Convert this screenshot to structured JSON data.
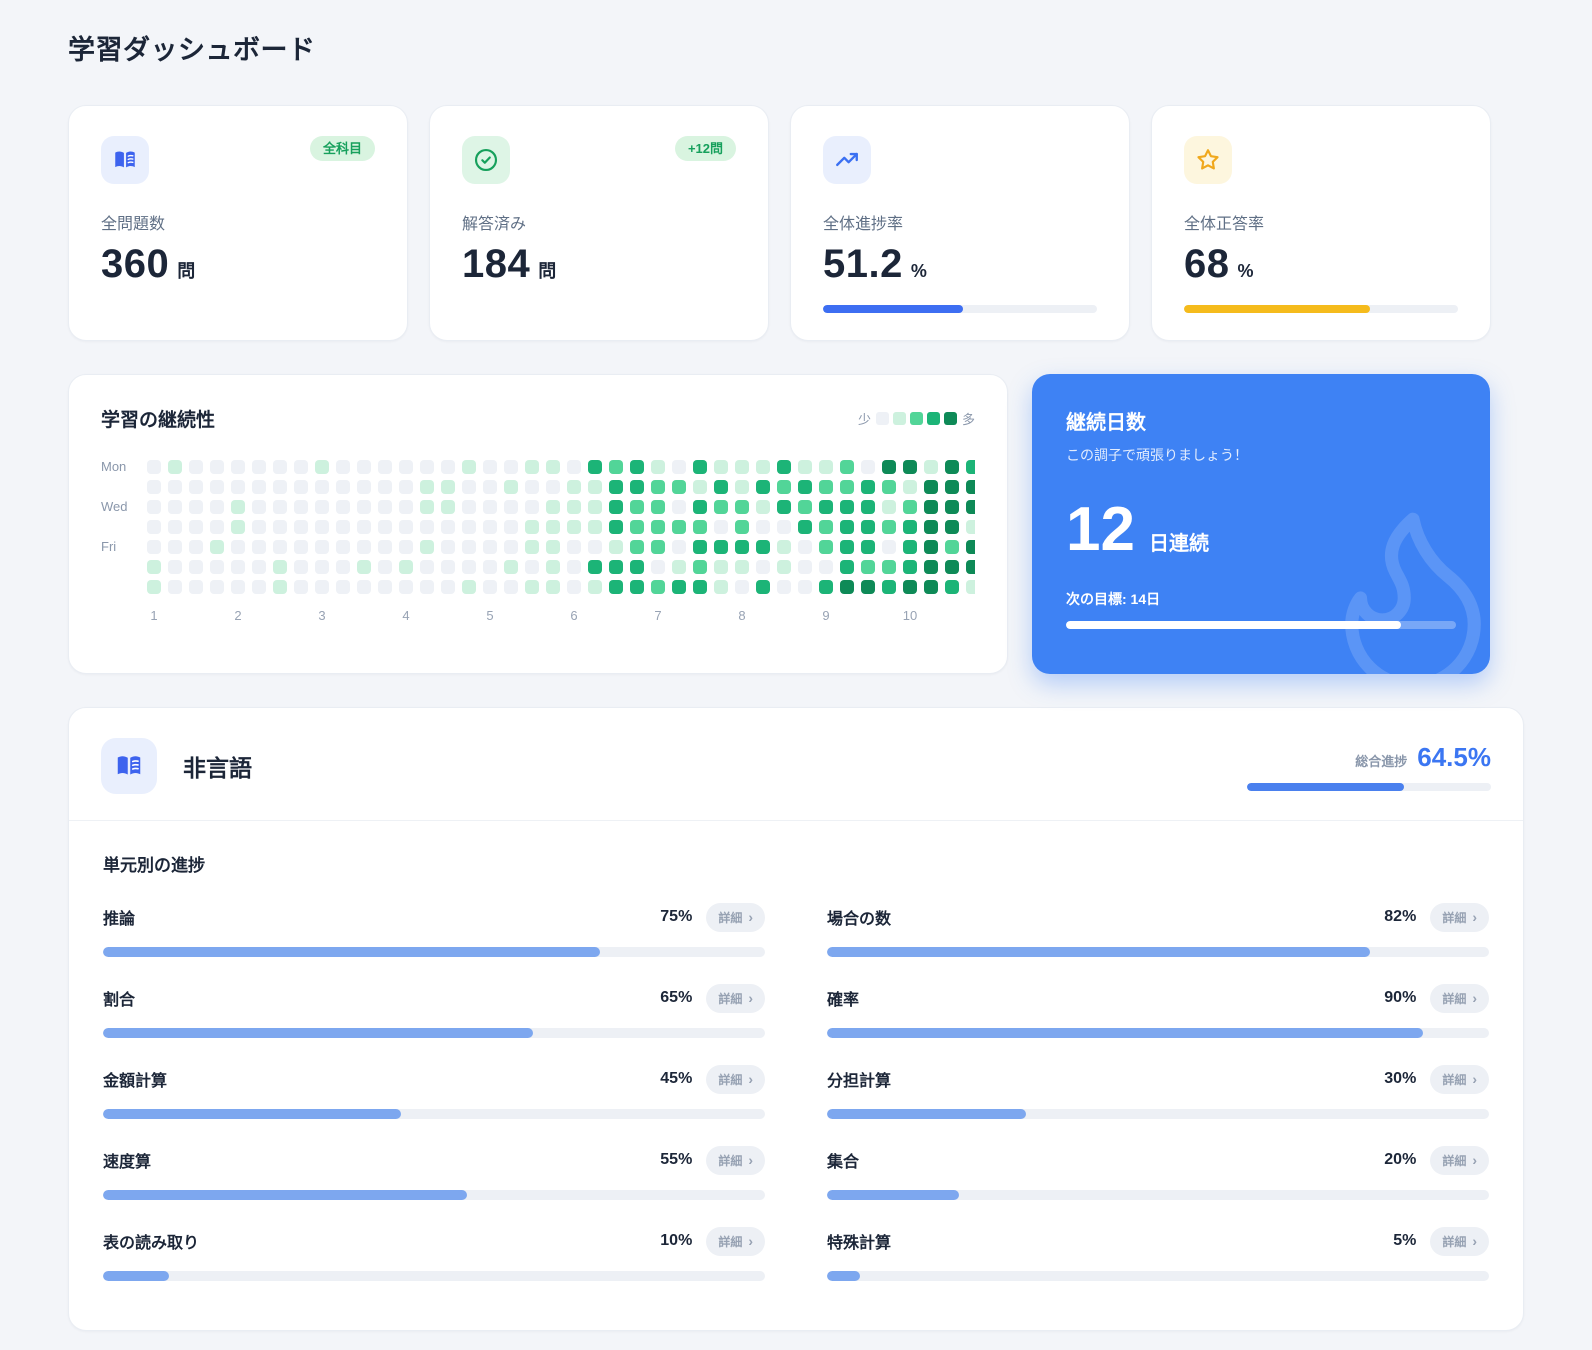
{
  "page": {
    "title": "学習ダッシュボード"
  },
  "colors": {
    "accent_blue": "#3e82f4",
    "royal_blue_bar": "#3d6ef2",
    "light_blue_bar": "#7da7ef",
    "yellow_bar": "#f5bb1c",
    "green": "#17a05c",
    "icon_blue": "#3d63ee",
    "star_yellow": "#f0a81c"
  },
  "stat_cards": [
    {
      "icon": "book-icon",
      "badge": "全科目",
      "label": "全問題数",
      "value": "360",
      "unit": "問"
    },
    {
      "icon": "check-circle-icon",
      "badge": "+12問",
      "label": "解答済み",
      "value": "184",
      "unit": "問"
    },
    {
      "icon": "trending-up-icon",
      "label": "全体進捗率",
      "value": "51.2",
      "unit": "%",
      "progress": 51.2,
      "bar_color": "#3d6ef2"
    },
    {
      "icon": "star-icon",
      "label": "全体正答率",
      "value": "68",
      "unit": "%",
      "progress": 68,
      "bar_color": "#f5bb1c"
    }
  ],
  "heatmap": {
    "title": "学習の継続性",
    "legend_low": "少",
    "legend_high": "多",
    "levels": [
      "#eef1f6",
      "#cdf1de",
      "#52d598",
      "#1cb477",
      "#0e8a57"
    ],
    "row_labels": [
      "Mon",
      "Wed",
      "Fri"
    ],
    "x_labels": [
      "1",
      "2",
      "3",
      "4",
      "5",
      "6",
      "7",
      "8",
      "9",
      "10"
    ],
    "grid": [
      [
        0,
        1,
        0,
        0,
        0,
        0,
        0,
        0,
        1,
        0,
        0,
        0,
        0,
        0,
        0,
        1,
        0,
        0,
        1,
        1,
        0,
        3,
        2,
        3,
        1,
        0,
        3,
        1,
        1,
        1,
        3,
        1,
        1,
        2,
        0,
        4,
        4,
        1,
        4,
        3
      ],
      [
        0,
        0,
        0,
        0,
        0,
        0,
        0,
        0,
        0,
        0,
        0,
        0,
        0,
        1,
        1,
        0,
        0,
        1,
        0,
        0,
        1,
        1,
        3,
        3,
        2,
        2,
        1,
        3,
        1,
        3,
        2,
        3,
        2,
        2,
        3,
        2,
        1,
        4,
        4,
        4
      ],
      [
        0,
        0,
        0,
        0,
        1,
        0,
        0,
        0,
        0,
        0,
        0,
        0,
        0,
        1,
        1,
        0,
        0,
        0,
        0,
        1,
        1,
        1,
        3,
        2,
        2,
        0,
        3,
        2,
        2,
        1,
        3,
        2,
        3,
        3,
        3,
        1,
        2,
        4,
        4,
        4
      ],
      [
        0,
        0,
        0,
        0,
        1,
        0,
        0,
        0,
        0,
        0,
        0,
        0,
        0,
        0,
        0,
        0,
        0,
        0,
        1,
        1,
        1,
        1,
        3,
        2,
        2,
        2,
        2,
        0,
        2,
        0,
        0,
        3,
        2,
        3,
        3,
        2,
        3,
        4,
        4,
        1
      ],
      [
        0,
        0,
        0,
        1,
        0,
        0,
        0,
        0,
        0,
        0,
        0,
        0,
        0,
        1,
        0,
        0,
        0,
        0,
        1,
        1,
        0,
        0,
        1,
        2,
        2,
        0,
        3,
        3,
        3,
        3,
        1,
        0,
        2,
        3,
        3,
        0,
        3,
        4,
        2,
        4
      ],
      [
        1,
        0,
        0,
        0,
        0,
        0,
        1,
        0,
        0,
        0,
        1,
        0,
        1,
        0,
        0,
        0,
        0,
        1,
        0,
        1,
        0,
        3,
        3,
        3,
        0,
        1,
        2,
        1,
        1,
        0,
        1,
        0,
        0,
        3,
        2,
        2,
        3,
        4,
        4,
        4
      ],
      [
        1,
        0,
        0,
        0,
        0,
        0,
        1,
        0,
        0,
        0,
        0,
        0,
        0,
        0,
        0,
        1,
        0,
        0,
        1,
        1,
        0,
        1,
        3,
        3,
        2,
        3,
        3,
        1,
        0,
        3,
        0,
        0,
        3,
        4,
        4,
        3,
        4,
        4,
        3,
        1
      ]
    ]
  },
  "streak": {
    "title": "継続日数",
    "subtitle": "この調子で頑張りましょう！",
    "value": "12",
    "unit": "日連続",
    "next_goal": "次の目標: 14日",
    "progress": 86,
    "icon": "flame-icon"
  },
  "subject": {
    "icon": "book-icon",
    "title": "非言語",
    "progress_label": "総合進捗",
    "progress_value": "64.5%",
    "progress": 64.5,
    "section_title": "単元別の進捗",
    "detail_label": "詳細",
    "units_left": [
      {
        "name": "推論",
        "percent": 75
      },
      {
        "name": "割合",
        "percent": 65
      },
      {
        "name": "金額計算",
        "percent": 45
      },
      {
        "name": "速度算",
        "percent": 55
      },
      {
        "name": "表の読み取り",
        "percent": 10
      }
    ],
    "units_right": [
      {
        "name": "場合の数",
        "percent": 82
      },
      {
        "name": "確率",
        "percent": 90
      },
      {
        "name": "分担計算",
        "percent": 30
      },
      {
        "name": "集合",
        "percent": 20
      },
      {
        "name": "特殊計算",
        "percent": 5
      }
    ]
  }
}
